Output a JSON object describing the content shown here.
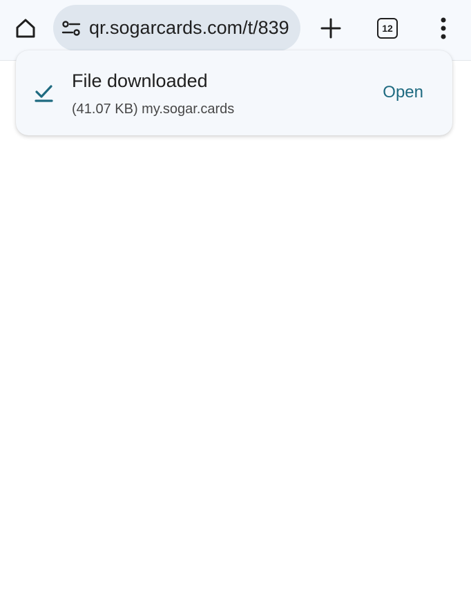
{
  "toolbar": {
    "url": "qr.sogarcards.com/t/839",
    "tab_count": "12",
    "icons": {
      "home": "home-icon",
      "site_info": "tune-icon",
      "new_tab": "plus-icon",
      "tabs": "tab-switcher-icon",
      "menu": "more-vert-icon"
    }
  },
  "download_message": {
    "title": "File downloaded",
    "subtitle": "(41.07 KB) my.sogar.cards",
    "action_label": "Open",
    "icon": "download-done-icon"
  },
  "colors": {
    "toolbar_bg": "#f6f9fd",
    "omnibox_bg": "#dfe6ee",
    "accent": "#1e6a80",
    "card_bg": "#f5f8fc"
  }
}
